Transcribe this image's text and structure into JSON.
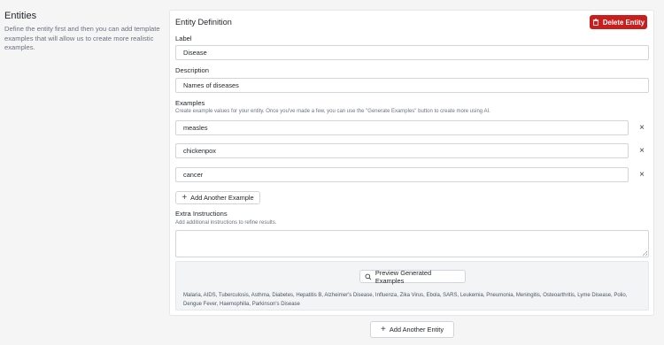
{
  "entities_section": {
    "title": "Entities",
    "description": "Define the entity first and then you can add template examples that will allow us to create more realistic examples."
  },
  "entity_card": {
    "title": "Entity Definition",
    "delete_label": "Delete Entity",
    "label_field": {
      "label": "Label",
      "value": "Disease"
    },
    "description_field": {
      "label": "Description",
      "value": "Names of diseases"
    },
    "examples": {
      "label": "Examples",
      "help": "Create example values for your entity. Once you've made a few, you can use the \"Generate Examples\" button to create more using AI.",
      "items": [
        "measles",
        "chickenpox",
        "cancer"
      ],
      "remove_glyph": "×",
      "add_label": "Add Another Example"
    },
    "extra_instructions": {
      "label": "Extra Instructions",
      "help": "Add additional instructions to refine results.",
      "value": ""
    },
    "preview": {
      "button_label": "Preview Generated Examples",
      "text": "Malaria, AIDS, Tuberculosis, Asthma, Diabetes, Hepatitis B, Alzheimer's Disease, Influenza, Zika Virus, Ebola, SARS, Leukemia, Pneumonia, Meningitis, Osteoarthritis, Lyme Disease, Polio, Dengue Fever, Haemophilia, Parkinson's Disease"
    }
  },
  "add_entity_label": "Add Another Entity",
  "icons": {
    "plus": "+",
    "delete": "trash-icon",
    "preview": "search-icon"
  },
  "colors": {
    "danger": "#c81e1e",
    "background": "#f5f5f6",
    "card": "#ffffff"
  }
}
